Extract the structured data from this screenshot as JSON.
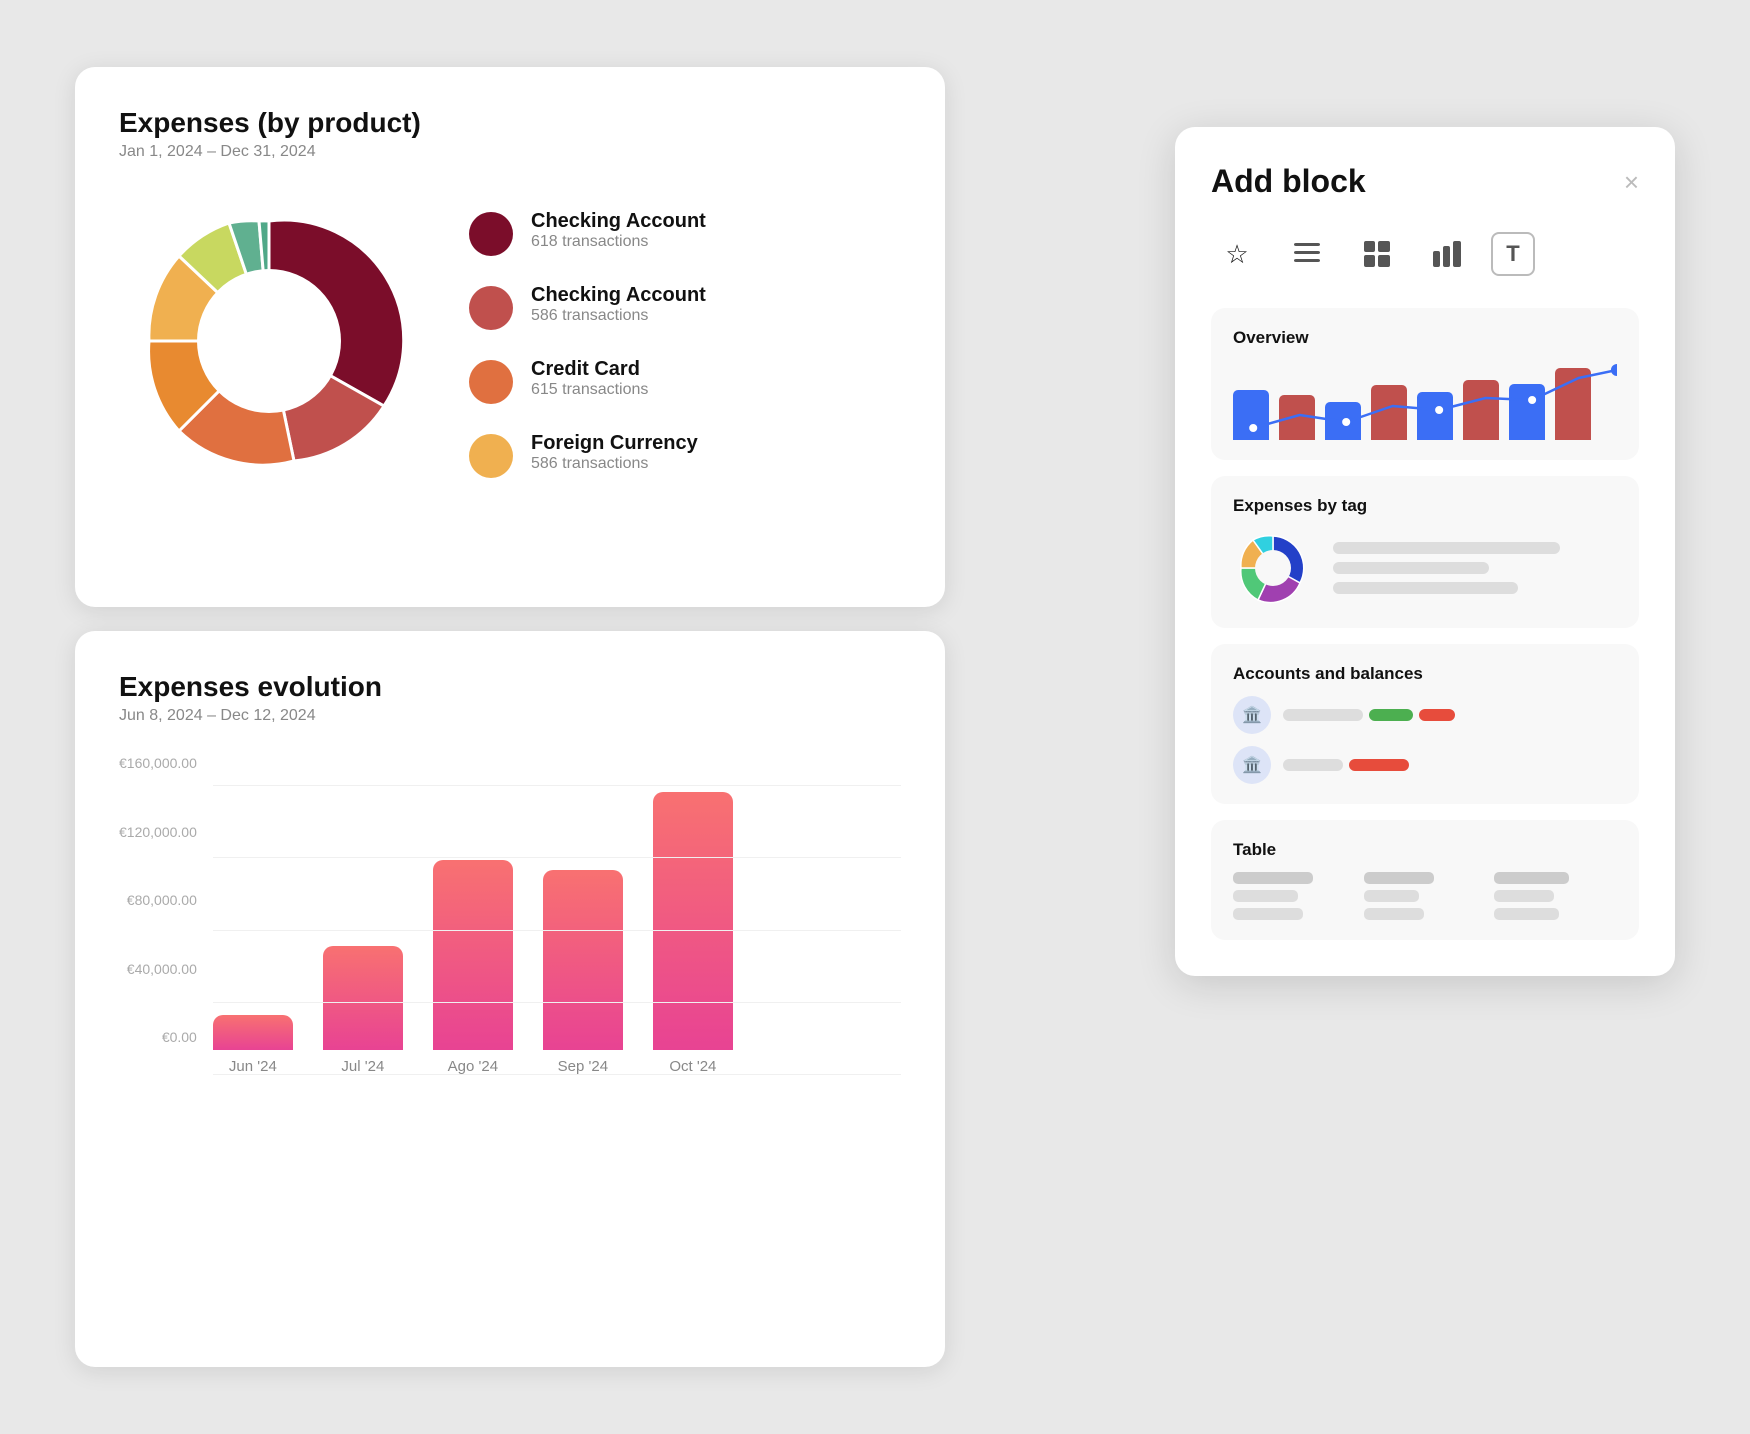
{
  "leftPanel1": {
    "title": "Expenses (by product)",
    "subtitle": "Jan 1, 2024 – Dec 31, 2024"
  },
  "leftPanel2": {
    "title": "Expenses evolution",
    "subtitle": "Jun 8, 2024 – Dec 12, 2024"
  },
  "legend": [
    {
      "id": "checking1",
      "label": "Checking Account",
      "count": "618 transactions",
      "color": "#7b0d2a"
    },
    {
      "id": "checking2",
      "label": "Checking Account",
      "count": "586 transactions",
      "color": "#c0504d"
    },
    {
      "id": "credit",
      "label": "Credit Card",
      "count": "615 transactions",
      "color": "#e07040"
    },
    {
      "id": "foreign",
      "label": "Foreign Currency",
      "count": "586 transactions",
      "color": "#f0b050"
    }
  ],
  "barChart": {
    "yLabels": [
      "€160,000.00",
      "€120,000.00",
      "€80,000.00",
      "€40,000.00",
      "€0.00"
    ],
    "bars": [
      {
        "label": "Jun '24",
        "heightPct": 12
      },
      {
        "label": "Jul '24",
        "heightPct": 36
      },
      {
        "label": "Ago '24",
        "heightPct": 66
      },
      {
        "label": "Sep '24",
        "heightPct": 62
      },
      {
        "label": "Oct '24",
        "heightPct": 90
      }
    ]
  },
  "addBlock": {
    "title": "Add block",
    "closeIcon": "×",
    "typeIcons": [
      {
        "id": "star",
        "symbol": "☆",
        "label": "favorites-icon"
      },
      {
        "id": "list",
        "symbol": "≡",
        "label": "list-icon"
      },
      {
        "id": "grid",
        "symbol": "⊞",
        "label": "grid-icon"
      },
      {
        "id": "bar",
        "symbol": "▦",
        "label": "bar-chart-icon"
      },
      {
        "id": "text",
        "symbol": "T",
        "label": "text-icon"
      }
    ],
    "cards": [
      {
        "id": "overview",
        "title": "Overview"
      },
      {
        "id": "expenses-tag",
        "title": "Expenses by tag"
      },
      {
        "id": "accounts",
        "title": "Accounts and balances"
      },
      {
        "id": "table",
        "title": "Table"
      }
    ]
  }
}
